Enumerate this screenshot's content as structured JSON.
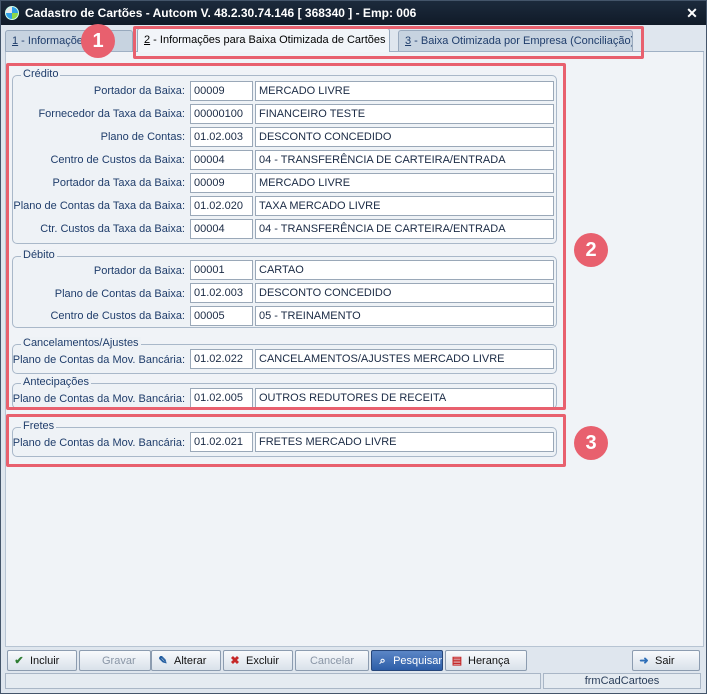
{
  "window": {
    "title": "Cadastro de Cartões  -  Autcom V. 48.2.30.74.146 [ 368340 ] - Emp: 006"
  },
  "tabs": [
    {
      "key": "1",
      "label": " - Informações"
    },
    {
      "key": "2",
      "label": " - Informações para Baixa Otimizada de Cartões"
    },
    {
      "key": "3",
      "label": " - Baixa Otimizada por Empresa (Conciliação)"
    }
  ],
  "credito": {
    "title": "Crédito",
    "rows": [
      {
        "label": "Portador da Baixa:",
        "code": "00009",
        "desc": "MERCADO LIVRE"
      },
      {
        "label": "Fornecedor da Taxa da Baixa:",
        "code": "00000100",
        "desc": "FINANCEIRO TESTE"
      },
      {
        "label": "Plano de Contas:",
        "code": "01.02.003",
        "desc": "DESCONTO CONCEDIDO"
      },
      {
        "label": "Centro de Custos da Baixa:",
        "code": "00004",
        "desc": "04 - TRANSFERÊNCIA DE CARTEIRA/ENTRADA"
      },
      {
        "label": "Portador da Taxa da Baixa:",
        "code": "00009",
        "desc": "MERCADO LIVRE"
      },
      {
        "label": "Plano de Contas da Taxa da Baixa:",
        "code": "01.02.020",
        "desc": "TAXA MERCADO LIVRE"
      },
      {
        "label": "Ctr. Custos da Taxa da Baixa:",
        "code": "00004",
        "desc": "04 - TRANSFERÊNCIA DE CARTEIRA/ENTRADA"
      }
    ]
  },
  "debito": {
    "title": "Débito",
    "rows": [
      {
        "label": "Portador da Baixa:",
        "code": "00001",
        "desc": "CARTAO"
      },
      {
        "label": "Plano de Contas da Baixa:",
        "code": "01.02.003",
        "desc": "DESCONTO CONCEDIDO"
      },
      {
        "label": "Centro de Custos da Baixa:",
        "code": "00005",
        "desc": "05 - TREINAMENTO"
      }
    ]
  },
  "cancelamentos": {
    "title": "Cancelamentos/Ajustes",
    "row": {
      "label": "Plano de Contas da Mov. Bancária:",
      "code": "01.02.022",
      "desc": "CANCELAMENTOS/AJUSTES MERCADO LIVRE"
    }
  },
  "antecipacoes": {
    "title": "Antecipações",
    "row": {
      "label": "Plano de Contas da Mov. Bancária:",
      "code": "01.02.005",
      "desc": "OUTROS REDUTORES DE RECEITA"
    }
  },
  "fretes": {
    "title": "Fretes",
    "row": {
      "label": "Plano de Contas da Mov. Bancária:",
      "code": "01.02.021",
      "desc": "FRETES MERCADO LIVRE"
    }
  },
  "badges": [
    "1",
    "2",
    "3"
  ],
  "toolbar": {
    "incluir": "Incluir",
    "gravar": "Gravar",
    "alterar": "Alterar",
    "excluir": "Excluir",
    "cancelar": "Cancelar",
    "pesquisar": "Pesquisar",
    "heranca": "Herança",
    "sair": "Sair"
  },
  "status": {
    "form_name": "frmCadCartoes"
  },
  "colors": {
    "highlight": "#e8606e",
    "titlebar": "#1c2a3c"
  }
}
